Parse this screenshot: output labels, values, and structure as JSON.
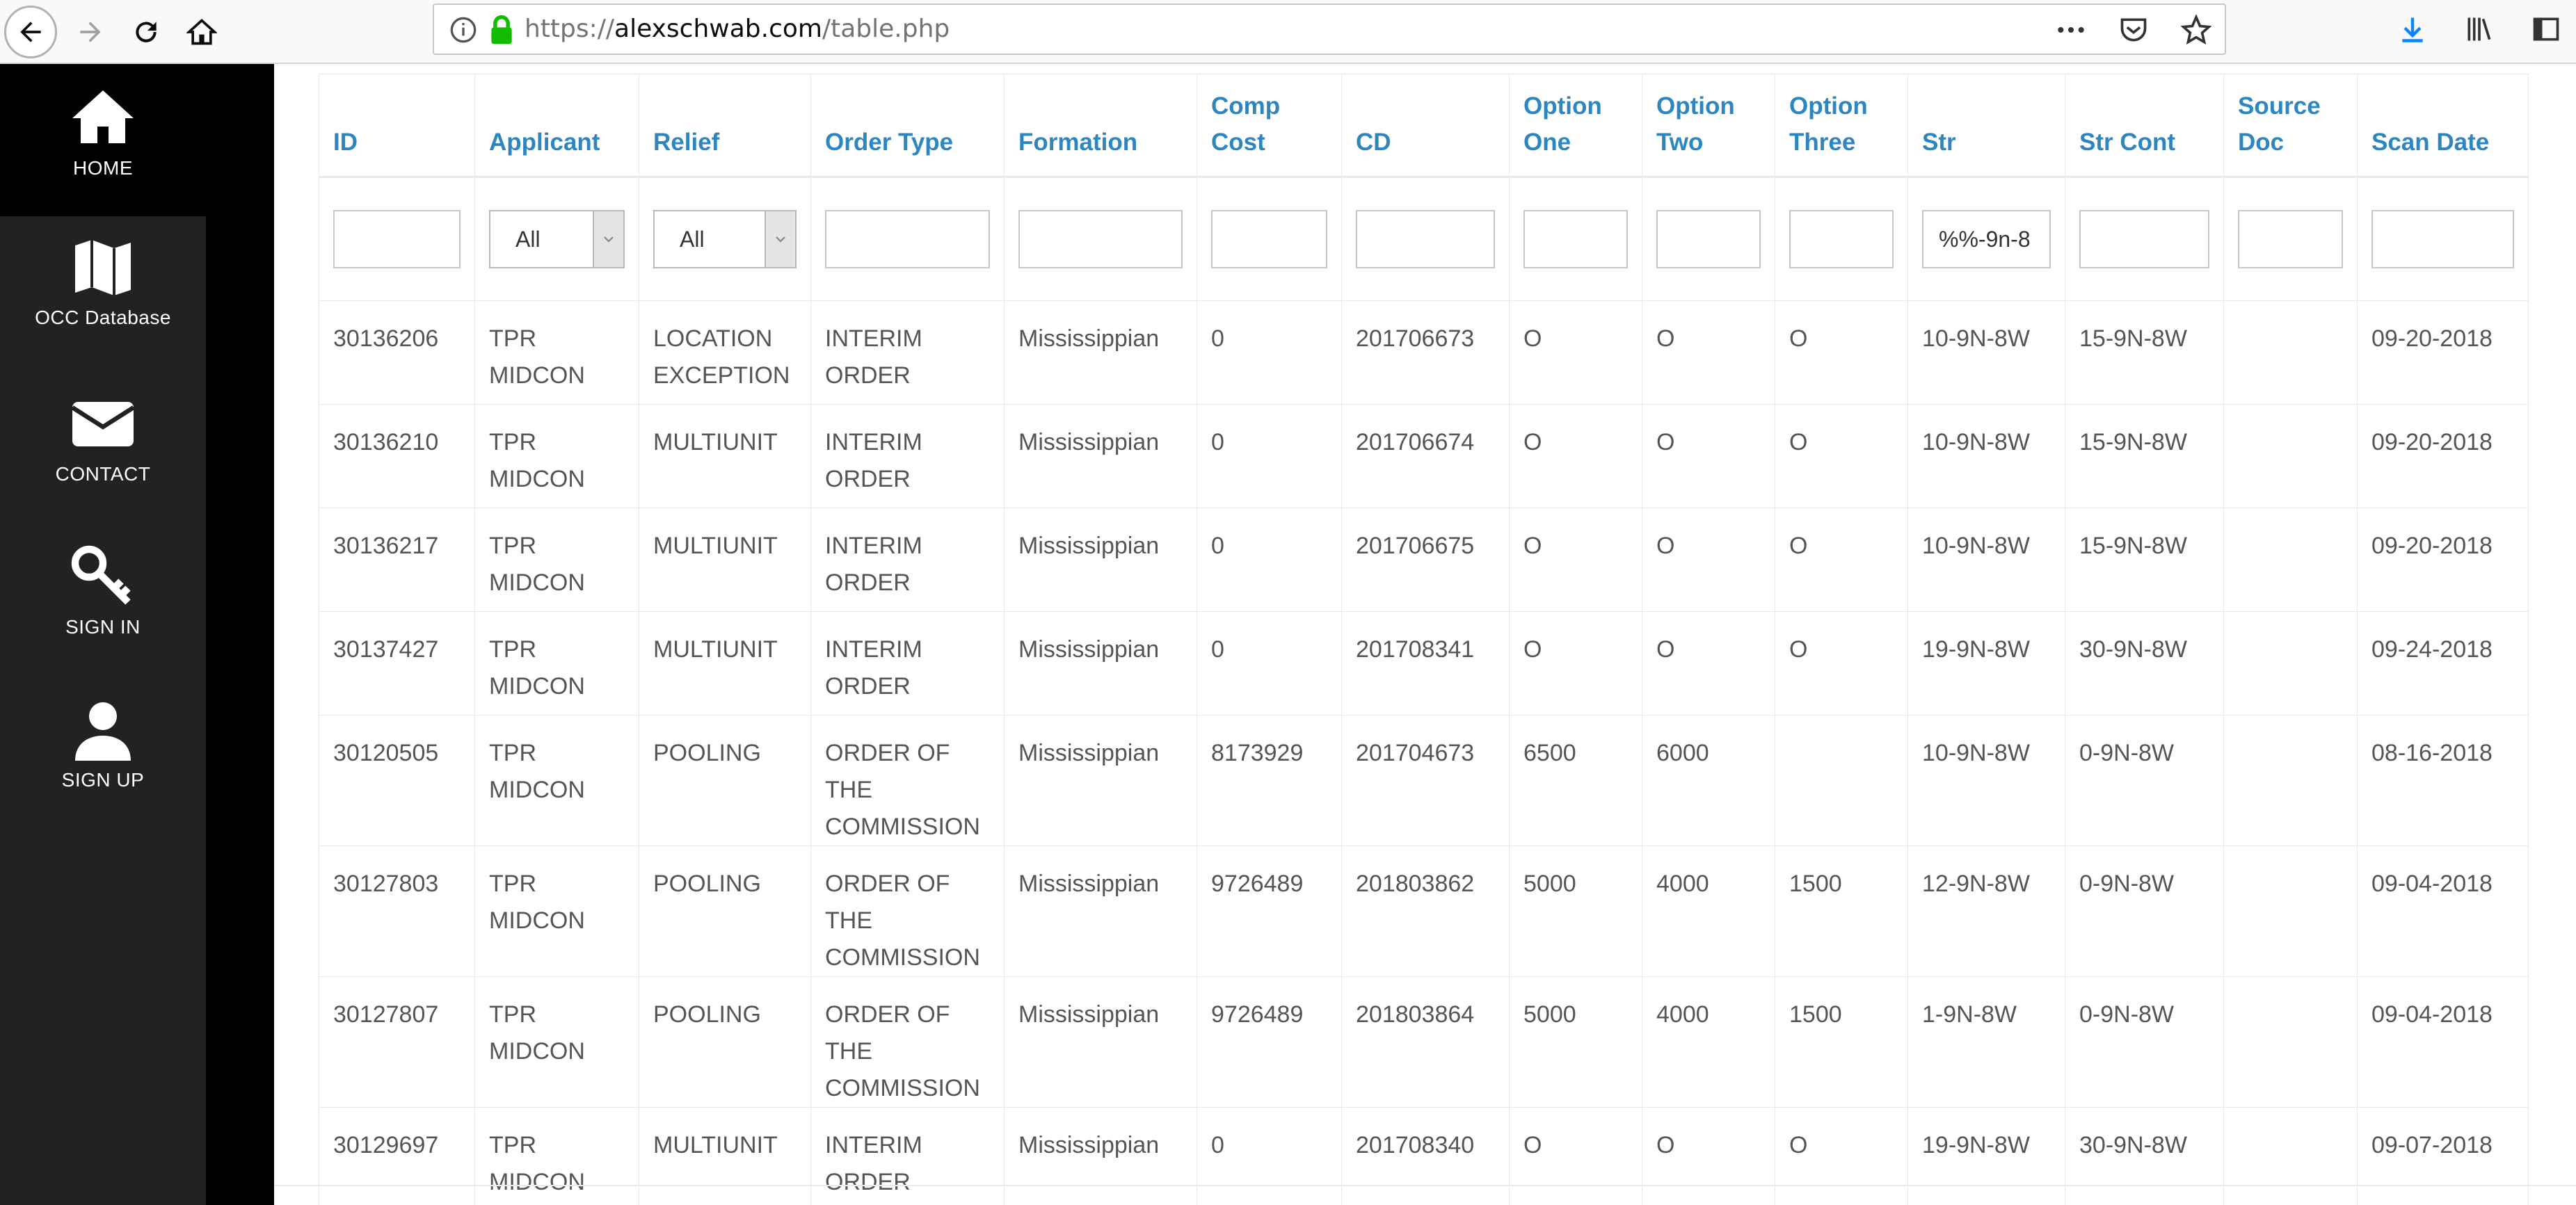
{
  "browser": {
    "url_prefix": "https://",
    "url_domain": "alexschwab.com",
    "url_path": "/table.php",
    "icons": [
      "back-icon",
      "forward-icon",
      "reload-icon",
      "home-icon",
      "info-icon",
      "lock-icon",
      "more-icon",
      "pocket-icon",
      "star-icon",
      "download-icon",
      "library-icon",
      "sidebar-icon"
    ]
  },
  "sidebar": {
    "items": [
      {
        "label": "HOME",
        "icon": "home-icon"
      },
      {
        "label": "OCC Database",
        "icon": "map-icon"
      },
      {
        "label": "CONTACT",
        "icon": "envelope-icon"
      },
      {
        "label": "SIGN IN",
        "icon": "key-icon"
      },
      {
        "label": "SIGN UP",
        "icon": "user-icon"
      }
    ]
  },
  "table": {
    "headers": [
      "ID",
      "Applicant",
      "Relief",
      "Order Type",
      "Formation",
      "Comp Cost",
      "CD",
      "Option One",
      "Option Two",
      "Option Three",
      "Str",
      "Str Cont",
      "Source Doc",
      "Scan Date"
    ],
    "filters": {
      "applicant_select": "All",
      "relief_select": "All",
      "str_value": "%%-9n-8"
    },
    "rows": [
      [
        "30136206",
        "TPR MIDCON",
        "LOCATION EXCEPTION",
        "INTERIM ORDER",
        "Mississippian",
        "0",
        "201706673",
        "O",
        "O",
        "O",
        "10-9N-8W",
        "15-9N-8W",
        "",
        "09-20-2018"
      ],
      [
        "30136210",
        "TPR MIDCON",
        "MULTIUNIT",
        "INTERIM ORDER",
        "Mississippian",
        "0",
        "201706674",
        "O",
        "O",
        "O",
        "10-9N-8W",
        "15-9N-8W",
        "",
        "09-20-2018"
      ],
      [
        "30136217",
        "TPR MIDCON",
        "MULTIUNIT",
        "INTERIM ORDER",
        "Mississippian",
        "0",
        "201706675",
        "O",
        "O",
        "O",
        "10-9N-8W",
        "15-9N-8W",
        "",
        "09-20-2018"
      ],
      [
        "30137427",
        "TPR MIDCON",
        "MULTIUNIT",
        "INTERIM ORDER",
        "Mississippian",
        "0",
        "201708341",
        "O",
        "O",
        "O",
        "19-9N-8W",
        "30-9N-8W",
        "",
        "09-24-2018"
      ],
      [
        "30120505",
        "TPR MIDCON",
        "POOLING",
        "ORDER OF THE COMMISSION",
        "Mississippian",
        "8173929",
        "201704673",
        "6500",
        "6000",
        "",
        "10-9N-8W",
        "0-9N-8W",
        "",
        "08-16-2018"
      ],
      [
        "30127803",
        "TPR MIDCON",
        "POOLING",
        "ORDER OF THE COMMISSION",
        "Mississippian",
        "9726489",
        "201803862",
        "5000",
        "4000",
        "1500",
        "12-9N-8W",
        "0-9N-8W",
        "",
        "09-04-2018"
      ],
      [
        "30127807",
        "TPR MIDCON",
        "POOLING",
        "ORDER OF THE COMMISSION",
        "Mississippian",
        "9726489",
        "201803864",
        "5000",
        "4000",
        "1500",
        "1-9N-8W",
        "0-9N-8W",
        "",
        "09-04-2018"
      ],
      [
        "30129697",
        "TPR MIDCON",
        "MULTIUNIT",
        "INTERIM ORDER",
        "Mississippian",
        "0",
        "201708340",
        "O",
        "O",
        "O",
        "19-9N-8W",
        "30-9N-8W",
        "",
        "09-07-2018"
      ]
    ]
  },
  "colors": {
    "header_text": "#2e86c1",
    "sidebar_bg": "#222222",
    "sidebar_active": "#000000"
  }
}
